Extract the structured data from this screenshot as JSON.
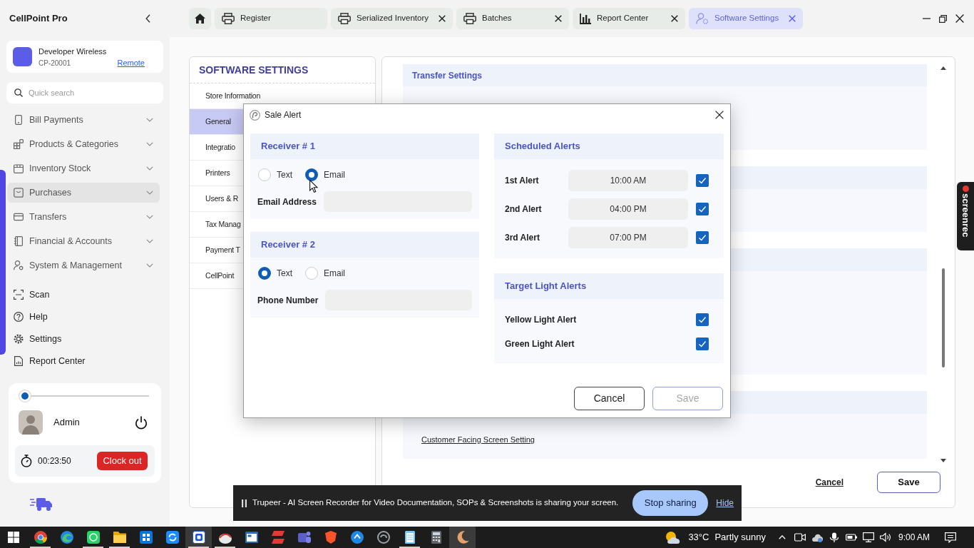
{
  "app": {
    "title": "CellPoint Pro"
  },
  "store": {
    "name": "Developer Wireless",
    "code": "CP-20001",
    "link": "Remote"
  },
  "search": {
    "placeholder": "Quick search"
  },
  "nav": [
    {
      "label": "Bill Payments",
      "selected": false
    },
    {
      "label": "Products & Categories",
      "selected": false
    },
    {
      "label": "Inventory Stock",
      "selected": false
    },
    {
      "label": "Purchases",
      "selected": true
    },
    {
      "label": "Transfers",
      "selected": false
    },
    {
      "label": "Financial & Accounts",
      "selected": false
    },
    {
      "label": "System & Management",
      "selected": false
    }
  ],
  "quick_links": [
    {
      "label": "Scan"
    },
    {
      "label": "Help"
    },
    {
      "label": "Settings"
    },
    {
      "label": "Report Center"
    }
  ],
  "user": {
    "slider": {
      "level": 0
    },
    "name": "Admin",
    "timer": "00:23:50",
    "clock_out": "Clock out"
  },
  "tabs": [
    {
      "label": "Register",
      "closable": false,
      "selected": false
    },
    {
      "label": "Serialized Inventory",
      "closable": true,
      "selected": false
    },
    {
      "label": "Batches",
      "closable": true,
      "selected": false
    },
    {
      "label": "Report Center",
      "closable": true,
      "selected": false
    },
    {
      "label": "Software Settings",
      "closable": true,
      "selected": true
    }
  ],
  "settings_menu": {
    "title": "SOFTWARE SETTINGS",
    "items": [
      {
        "label": "Store Information",
        "selected": false
      },
      {
        "label": "General",
        "selected": true
      },
      {
        "label": "Integratio",
        "selected": false
      },
      {
        "label": "Printers",
        "selected": false
      },
      {
        "label": "Users & R",
        "selected": false
      },
      {
        "label": "Tax Manag",
        "selected": false
      },
      {
        "label": "Payment T",
        "selected": false
      },
      {
        "label": "CellPoint",
        "selected": false
      }
    ]
  },
  "settings_panel": {
    "section_title": "Transfer Settings",
    "link": "Customer Facing Screen Setting",
    "cancel": "Cancel",
    "save": "Save"
  },
  "dialog": {
    "title": "Sale Alert",
    "receivers": [
      {
        "title": "Receiver # 1",
        "options": [
          {
            "label": "Text",
            "selected": false
          },
          {
            "label": "Email",
            "selected": true
          }
        ],
        "field_label": "Email Address"
      },
      {
        "title": "Receiver # 2",
        "options": [
          {
            "label": "Text",
            "selected": true
          },
          {
            "label": "Email",
            "selected": false
          }
        ],
        "field_label": "Phone Number"
      }
    ],
    "scheduled_alerts": {
      "title": "Scheduled Alerts",
      "alerts": [
        {
          "label": "1st Alert",
          "time": "10:00 AM",
          "checked": true
        },
        {
          "label": "2nd Alert",
          "time": "04:00 PM",
          "checked": true
        },
        {
          "label": "3rd Alert",
          "time": "07:00 PM",
          "checked": true
        }
      ]
    },
    "target_light_alerts": {
      "title": "Target Light Alerts",
      "alerts": [
        {
          "label": "Yellow Light Alert",
          "checked": true
        },
        {
          "label": "Green Light Alert",
          "checked": true
        }
      ]
    },
    "buttons": [
      {
        "label": "Cancel",
        "disabled": false
      },
      {
        "label": "Save",
        "disabled": true
      }
    ]
  },
  "share_bar": {
    "message": "Trupeer - AI Screen Recorder for Video Documentation, SOPs & Screenshots is sharing your screen.",
    "stop": "Stop sharing",
    "hide": "Hide"
  },
  "recorder_tab": {
    "label": "screenrec"
  },
  "taskbar": {
    "apps": [
      {
        "active": false,
        "running": true
      },
      {
        "active": false,
        "running": false
      },
      {
        "active": false,
        "running": true
      },
      {
        "active": false,
        "running": true
      },
      {
        "active": false,
        "running": false
      },
      {
        "active": false,
        "running": false
      },
      {
        "active": true,
        "running": true
      },
      {
        "active": false,
        "running": true
      },
      {
        "active": false,
        "running": false
      },
      {
        "active": false,
        "running": false
      },
      {
        "active": false,
        "running": false
      },
      {
        "active": false,
        "running": false
      },
      {
        "active": false,
        "running": false
      },
      {
        "active": false,
        "running": false
      },
      {
        "active": false,
        "running": true
      },
      {
        "active": false,
        "running": false
      },
      {
        "active": true,
        "running": false
      }
    ],
    "weather": {
      "temperature": "33°C",
      "condition": "Partly sunny"
    },
    "time": "9:00 AM"
  }
}
